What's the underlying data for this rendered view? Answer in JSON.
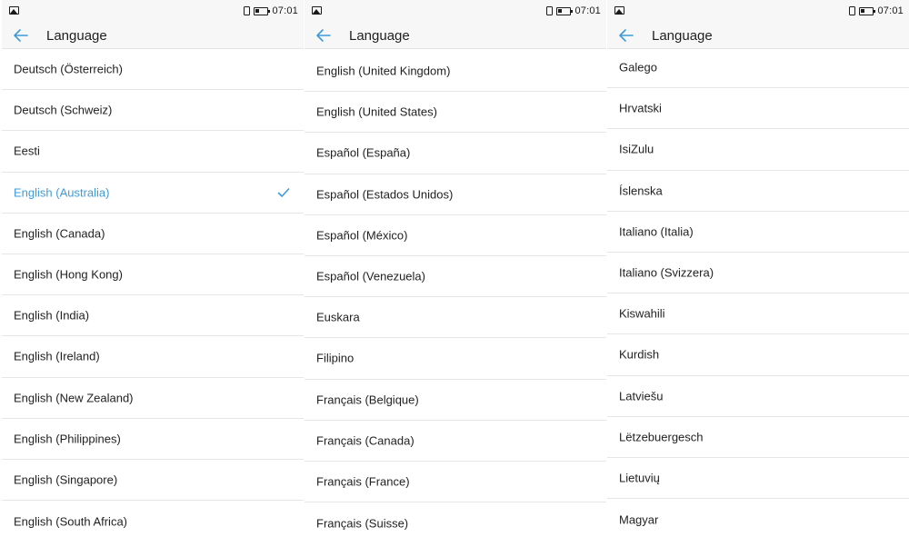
{
  "accent_color": "#3f9bd8",
  "screens": [
    {
      "status": {
        "time": "07:01",
        "left_icon": "gallery-notification-icon"
      },
      "title": "Language",
      "items": [
        {
          "label": "Deutsch (Österreich)",
          "selected": false
        },
        {
          "label": "Deutsch (Schweiz)",
          "selected": false
        },
        {
          "label": "Eesti",
          "selected": false
        },
        {
          "label": "English (Australia)",
          "selected": true
        },
        {
          "label": "English (Canada)",
          "selected": false
        },
        {
          "label": "English (Hong Kong)",
          "selected": false
        },
        {
          "label": "English (India)",
          "selected": false
        },
        {
          "label": "English (Ireland)",
          "selected": false
        },
        {
          "label": "English (New Zealand)",
          "selected": false
        },
        {
          "label": "English (Philippines)",
          "selected": false
        },
        {
          "label": "English (Singapore)",
          "selected": false
        },
        {
          "label": "English (South Africa)",
          "selected": false
        }
      ]
    },
    {
      "status": {
        "time": "07:01",
        "left_icon": "gallery-notification-icon"
      },
      "title": "Language",
      "items": [
        {
          "label": "English (United Kingdom)",
          "selected": false
        },
        {
          "label": "English (United States)",
          "selected": false
        },
        {
          "label": "Español (España)",
          "selected": false
        },
        {
          "label": "Español (Estados Unidos)",
          "selected": false
        },
        {
          "label": "Español (México)",
          "selected": false
        },
        {
          "label": "Español (Venezuela)",
          "selected": false
        },
        {
          "label": "Euskara",
          "selected": false
        },
        {
          "label": "Filipino",
          "selected": false
        },
        {
          "label": "Français (Belgique)",
          "selected": false
        },
        {
          "label": "Français (Canada)",
          "selected": false
        },
        {
          "label": "Français (France)",
          "selected": false
        },
        {
          "label": "Français (Suisse)",
          "selected": false
        }
      ]
    },
    {
      "status": {
        "time": "07:01",
        "left_icon": "gallery-notification-icon"
      },
      "title": "Language",
      "items": [
        {
          "label": "Galego",
          "selected": false
        },
        {
          "label": "Hrvatski",
          "selected": false
        },
        {
          "label": "IsiZulu",
          "selected": false
        },
        {
          "label": "Íslenska",
          "selected": false
        },
        {
          "label": "Italiano (Italia)",
          "selected": false
        },
        {
          "label": "Italiano (Svizzera)",
          "selected": false
        },
        {
          "label": "Kiswahili",
          "selected": false
        },
        {
          "label": "Kurdish",
          "selected": false
        },
        {
          "label": "Latviešu",
          "selected": false
        },
        {
          "label": "Lëtzebuergesch",
          "selected": false
        },
        {
          "label": "Lietuvių",
          "selected": false
        },
        {
          "label": "Magyar",
          "selected": false
        }
      ]
    }
  ]
}
